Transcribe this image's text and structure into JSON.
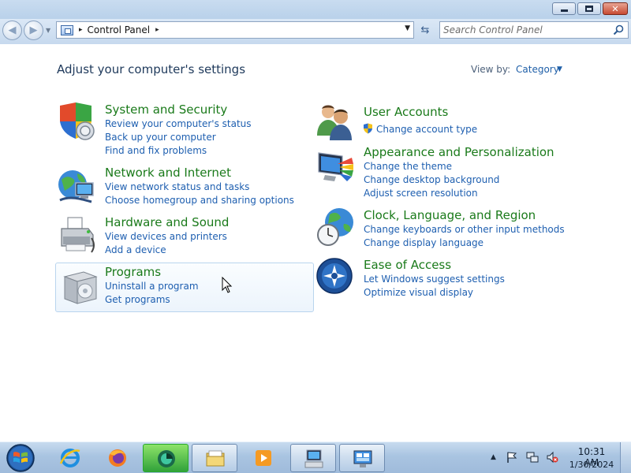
{
  "window": {
    "minimize_glyph": "",
    "restore_glyph": "",
    "close_glyph": "✕",
    "back_glyph": "◀",
    "forward_glyph": "▶"
  },
  "address": {
    "root_sep": "▸",
    "crumb": "Control Panel",
    "crumb_sep": "▸",
    "dropdown_glyph": "▼",
    "refresh_glyph": "⇆"
  },
  "search": {
    "placeholder": "Search Control Panel"
  },
  "page": {
    "title": "Adjust your computer's settings",
    "view_by_label": "View by:",
    "view_by_value": "Category",
    "view_by_caret": "▼"
  },
  "categories": {
    "system_security": {
      "title": "System and Security",
      "links": [
        "Review your computer's status",
        "Back up your computer",
        "Find and fix problems"
      ]
    },
    "network_internet": {
      "title": "Network and Internet",
      "links": [
        "View network status and tasks",
        "Choose homegroup and sharing options"
      ]
    },
    "hardware_sound": {
      "title": "Hardware and Sound",
      "links": [
        "View devices and printers",
        "Add a device"
      ]
    },
    "programs": {
      "title": "Programs",
      "links": [
        "Uninstall a program",
        "Get programs"
      ]
    },
    "user_accounts": {
      "title": "User Accounts",
      "links": [
        "Change account type"
      ]
    },
    "appearance": {
      "title": "Appearance and Personalization",
      "links": [
        "Change the theme",
        "Change desktop background",
        "Adjust screen resolution"
      ]
    },
    "clock_region": {
      "title": "Clock, Language, and Region",
      "links": [
        "Change keyboards or other input methods",
        "Change display language"
      ]
    },
    "ease_access": {
      "title": "Ease of Access",
      "links": [
        "Let Windows suggest settings",
        "Optimize visual display"
      ]
    }
  },
  "taskbar": {
    "tray_expand_glyph": "▲",
    "time": "10:31 AM",
    "date": "1/30/2024"
  },
  "colors": {
    "category_title": "#1a7a1a",
    "link": "#1e5fb0",
    "heading": "#1e395b"
  }
}
